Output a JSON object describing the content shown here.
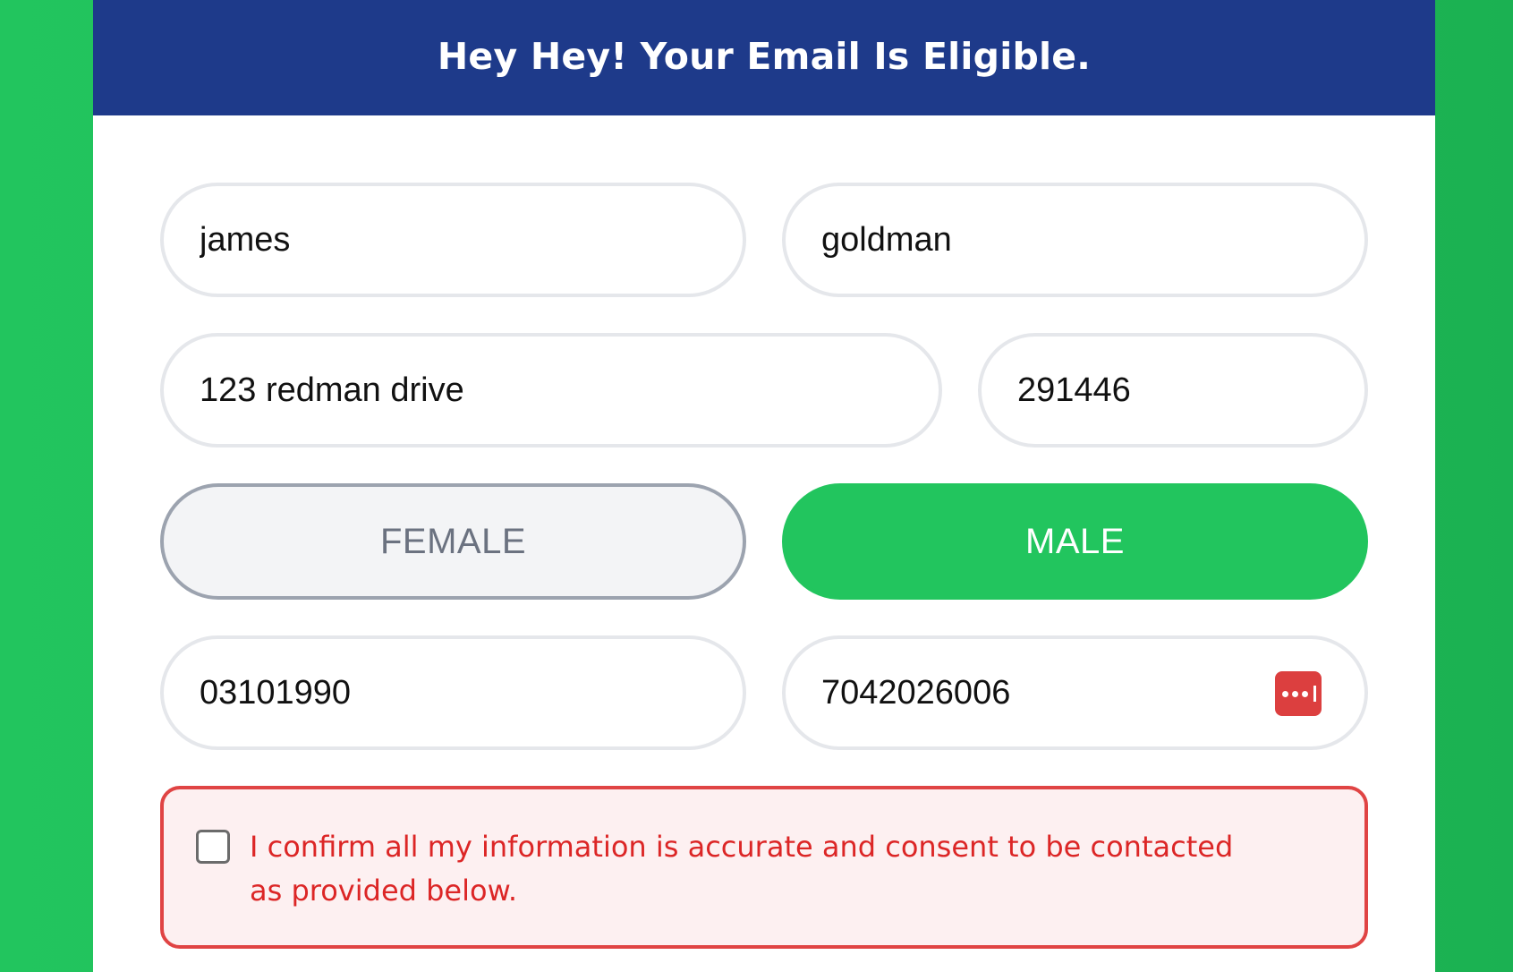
{
  "header": {
    "title": "Hey Hey! Your Email Is Eligible."
  },
  "form": {
    "first_name": "james",
    "last_name": "goldman",
    "address": "123 redman drive",
    "zip": "291446",
    "gender": {
      "female_label": "FEMALE",
      "male_label": "MALE",
      "selected": "MALE"
    },
    "dob": "03101990",
    "phone": "7042026006",
    "password_manager_icon": "password-manager-icon",
    "consent": {
      "checked": false,
      "text": "I confirm all my information is accurate and consent to be contacted as provided below."
    }
  },
  "colors": {
    "background": "#22c55e",
    "header": "#1e3a8a",
    "selected_button": "#22c55e",
    "consent_border": "#e04444",
    "consent_text": "#dc2626"
  }
}
